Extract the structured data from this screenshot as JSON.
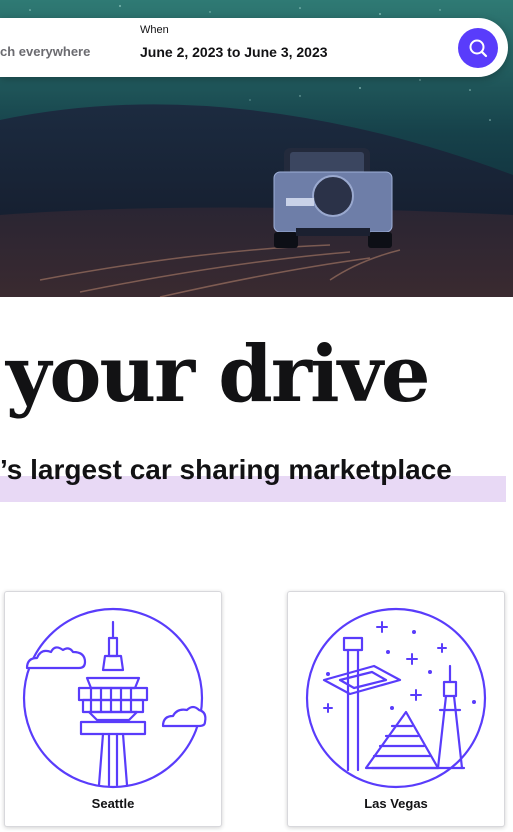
{
  "colors": {
    "brand": "#593cfb",
    "highlight": "#e8d9f5",
    "text": "#121214",
    "muted": "#6b6b70"
  },
  "search": {
    "where_text": "ch everywhere",
    "when_label": "When",
    "when_value": "June 2, 2023 to June 3, 2023",
    "button_icon": "search-icon"
  },
  "hero": {
    "headline": "your drive",
    "subheadline": "’s largest car sharing marketplace"
  },
  "destinations": [
    {
      "label": "Seattle",
      "icon": "space-needle-icon"
    },
    {
      "label": "Las Vegas",
      "icon": "las-vegas-skyline-icon"
    }
  ]
}
